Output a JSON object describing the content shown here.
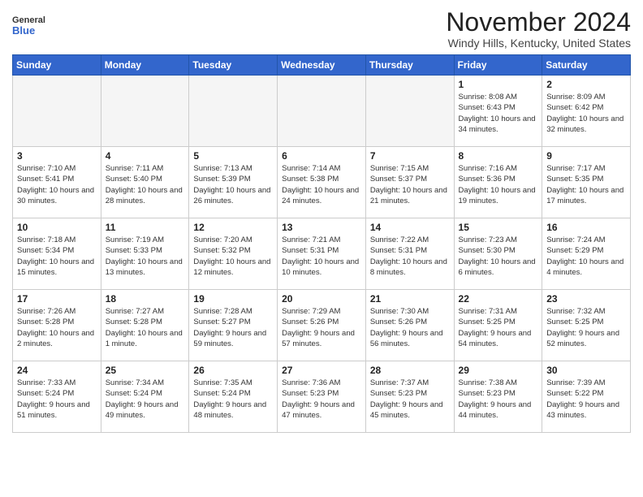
{
  "header": {
    "logo_line1": "General",
    "logo_line2": "Blue",
    "month_title": "November 2024",
    "location": "Windy Hills, Kentucky, United States"
  },
  "weekdays": [
    "Sunday",
    "Monday",
    "Tuesday",
    "Wednesday",
    "Thursday",
    "Friday",
    "Saturday"
  ],
  "weeks": [
    [
      {
        "num": "",
        "sunrise": "",
        "sunset": "",
        "daylight": "",
        "empty": true
      },
      {
        "num": "",
        "sunrise": "",
        "sunset": "",
        "daylight": "",
        "empty": true
      },
      {
        "num": "",
        "sunrise": "",
        "sunset": "",
        "daylight": "",
        "empty": true
      },
      {
        "num": "",
        "sunrise": "",
        "sunset": "",
        "daylight": "",
        "empty": true
      },
      {
        "num": "",
        "sunrise": "",
        "sunset": "",
        "daylight": "",
        "empty": true
      },
      {
        "num": "1",
        "sunrise": "Sunrise: 8:08 AM",
        "sunset": "Sunset: 6:43 PM",
        "daylight": "Daylight: 10 hours and 34 minutes.",
        "empty": false
      },
      {
        "num": "2",
        "sunrise": "Sunrise: 8:09 AM",
        "sunset": "Sunset: 6:42 PM",
        "daylight": "Daylight: 10 hours and 32 minutes.",
        "empty": false
      }
    ],
    [
      {
        "num": "3",
        "sunrise": "Sunrise: 7:10 AM",
        "sunset": "Sunset: 5:41 PM",
        "daylight": "Daylight: 10 hours and 30 minutes.",
        "empty": false
      },
      {
        "num": "4",
        "sunrise": "Sunrise: 7:11 AM",
        "sunset": "Sunset: 5:40 PM",
        "daylight": "Daylight: 10 hours and 28 minutes.",
        "empty": false
      },
      {
        "num": "5",
        "sunrise": "Sunrise: 7:13 AM",
        "sunset": "Sunset: 5:39 PM",
        "daylight": "Daylight: 10 hours and 26 minutes.",
        "empty": false
      },
      {
        "num": "6",
        "sunrise": "Sunrise: 7:14 AM",
        "sunset": "Sunset: 5:38 PM",
        "daylight": "Daylight: 10 hours and 24 minutes.",
        "empty": false
      },
      {
        "num": "7",
        "sunrise": "Sunrise: 7:15 AM",
        "sunset": "Sunset: 5:37 PM",
        "daylight": "Daylight: 10 hours and 21 minutes.",
        "empty": false
      },
      {
        "num": "8",
        "sunrise": "Sunrise: 7:16 AM",
        "sunset": "Sunset: 5:36 PM",
        "daylight": "Daylight: 10 hours and 19 minutes.",
        "empty": false
      },
      {
        "num": "9",
        "sunrise": "Sunrise: 7:17 AM",
        "sunset": "Sunset: 5:35 PM",
        "daylight": "Daylight: 10 hours and 17 minutes.",
        "empty": false
      }
    ],
    [
      {
        "num": "10",
        "sunrise": "Sunrise: 7:18 AM",
        "sunset": "Sunset: 5:34 PM",
        "daylight": "Daylight: 10 hours and 15 minutes.",
        "empty": false
      },
      {
        "num": "11",
        "sunrise": "Sunrise: 7:19 AM",
        "sunset": "Sunset: 5:33 PM",
        "daylight": "Daylight: 10 hours and 13 minutes.",
        "empty": false
      },
      {
        "num": "12",
        "sunrise": "Sunrise: 7:20 AM",
        "sunset": "Sunset: 5:32 PM",
        "daylight": "Daylight: 10 hours and 12 minutes.",
        "empty": false
      },
      {
        "num": "13",
        "sunrise": "Sunrise: 7:21 AM",
        "sunset": "Sunset: 5:31 PM",
        "daylight": "Daylight: 10 hours and 10 minutes.",
        "empty": false
      },
      {
        "num": "14",
        "sunrise": "Sunrise: 7:22 AM",
        "sunset": "Sunset: 5:31 PM",
        "daylight": "Daylight: 10 hours and 8 minutes.",
        "empty": false
      },
      {
        "num": "15",
        "sunrise": "Sunrise: 7:23 AM",
        "sunset": "Sunset: 5:30 PM",
        "daylight": "Daylight: 10 hours and 6 minutes.",
        "empty": false
      },
      {
        "num": "16",
        "sunrise": "Sunrise: 7:24 AM",
        "sunset": "Sunset: 5:29 PM",
        "daylight": "Daylight: 10 hours and 4 minutes.",
        "empty": false
      }
    ],
    [
      {
        "num": "17",
        "sunrise": "Sunrise: 7:26 AM",
        "sunset": "Sunset: 5:28 PM",
        "daylight": "Daylight: 10 hours and 2 minutes.",
        "empty": false
      },
      {
        "num": "18",
        "sunrise": "Sunrise: 7:27 AM",
        "sunset": "Sunset: 5:28 PM",
        "daylight": "Daylight: 10 hours and 1 minute.",
        "empty": false
      },
      {
        "num": "19",
        "sunrise": "Sunrise: 7:28 AM",
        "sunset": "Sunset: 5:27 PM",
        "daylight": "Daylight: 9 hours and 59 minutes.",
        "empty": false
      },
      {
        "num": "20",
        "sunrise": "Sunrise: 7:29 AM",
        "sunset": "Sunset: 5:26 PM",
        "daylight": "Daylight: 9 hours and 57 minutes.",
        "empty": false
      },
      {
        "num": "21",
        "sunrise": "Sunrise: 7:30 AM",
        "sunset": "Sunset: 5:26 PM",
        "daylight": "Daylight: 9 hours and 56 minutes.",
        "empty": false
      },
      {
        "num": "22",
        "sunrise": "Sunrise: 7:31 AM",
        "sunset": "Sunset: 5:25 PM",
        "daylight": "Daylight: 9 hours and 54 minutes.",
        "empty": false
      },
      {
        "num": "23",
        "sunrise": "Sunrise: 7:32 AM",
        "sunset": "Sunset: 5:25 PM",
        "daylight": "Daylight: 9 hours and 52 minutes.",
        "empty": false
      }
    ],
    [
      {
        "num": "24",
        "sunrise": "Sunrise: 7:33 AM",
        "sunset": "Sunset: 5:24 PM",
        "daylight": "Daylight: 9 hours and 51 minutes.",
        "empty": false
      },
      {
        "num": "25",
        "sunrise": "Sunrise: 7:34 AM",
        "sunset": "Sunset: 5:24 PM",
        "daylight": "Daylight: 9 hours and 49 minutes.",
        "empty": false
      },
      {
        "num": "26",
        "sunrise": "Sunrise: 7:35 AM",
        "sunset": "Sunset: 5:24 PM",
        "daylight": "Daylight: 9 hours and 48 minutes.",
        "empty": false
      },
      {
        "num": "27",
        "sunrise": "Sunrise: 7:36 AM",
        "sunset": "Sunset: 5:23 PM",
        "daylight": "Daylight: 9 hours and 47 minutes.",
        "empty": false
      },
      {
        "num": "28",
        "sunrise": "Sunrise: 7:37 AM",
        "sunset": "Sunset: 5:23 PM",
        "daylight": "Daylight: 9 hours and 45 minutes.",
        "empty": false
      },
      {
        "num": "29",
        "sunrise": "Sunrise: 7:38 AM",
        "sunset": "Sunset: 5:23 PM",
        "daylight": "Daylight: 9 hours and 44 minutes.",
        "empty": false
      },
      {
        "num": "30",
        "sunrise": "Sunrise: 7:39 AM",
        "sunset": "Sunset: 5:22 PM",
        "daylight": "Daylight: 9 hours and 43 minutes.",
        "empty": false
      }
    ]
  ]
}
